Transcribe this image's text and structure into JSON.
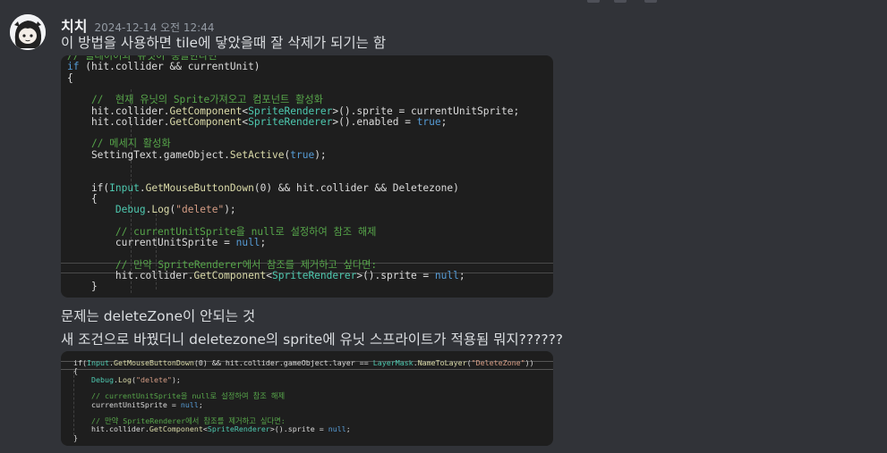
{
  "message": {
    "username": "치치",
    "timestamp": "2024-12-14 오전 12:44",
    "line1": "이 방법을 사용하면 tile에 닿았을때 잘 삭제가 되기는 함",
    "line2": "문제는 deleteZone이 안되는 것",
    "line3": "새 조건으로 바꿨더니 deletezone의 sprite에 유닛 스프라이트가 적용됨 뭐지??????"
  },
  "code1": {
    "lines": [
      [
        {
          "t": "// 플레이어와 유닛이 충돌한다면",
          "c": "cm"
        }
      ],
      [
        {
          "t": "if",
          "c": "kw"
        },
        {
          "t": " (hit.collider && currentUnit)",
          "c": "pl"
        }
      ],
      [
        {
          "t": "{",
          "c": "pl"
        }
      ],
      [
        {
          "t": "",
          "c": "pl"
        }
      ],
      [
        {
          "t": "    //  현재 유닛의 Sprite가져오고 컴포넌트 활성화",
          "c": "cm"
        }
      ],
      [
        {
          "t": "    hit.collider.",
          "c": "pl"
        },
        {
          "t": "GetComponent",
          "c": "fn"
        },
        {
          "t": "<",
          "c": "pl"
        },
        {
          "t": "SpriteRenderer",
          "c": "ty"
        },
        {
          "t": ">().sprite = currentUnitSprite;",
          "c": "pl"
        }
      ],
      [
        {
          "t": "    hit.collider.",
          "c": "pl"
        },
        {
          "t": "GetComponent",
          "c": "fn"
        },
        {
          "t": "<",
          "c": "pl"
        },
        {
          "t": "SpriteRenderer",
          "c": "ty"
        },
        {
          "t": ">().enabled = ",
          "c": "pl"
        },
        {
          "t": "true",
          "c": "kw"
        },
        {
          "t": ";",
          "c": "pl"
        }
      ],
      [
        {
          "t": "",
          "c": "pl"
        }
      ],
      [
        {
          "t": "    // 메세지 활성화",
          "c": "cm"
        }
      ],
      [
        {
          "t": "    SettingText.gameObject.",
          "c": "pl"
        },
        {
          "t": "SetActive",
          "c": "fn"
        },
        {
          "t": "(",
          "c": "pl"
        },
        {
          "t": "true",
          "c": "kw"
        },
        {
          "t": ");",
          "c": "pl"
        }
      ],
      [
        {
          "t": "",
          "c": "pl"
        }
      ],
      [
        {
          "t": "",
          "c": "pl"
        }
      ],
      [
        {
          "t": "    if(",
          "c": "pl"
        },
        {
          "t": "Input",
          "c": "ty"
        },
        {
          "t": ".",
          "c": "pl"
        },
        {
          "t": "GetMouseButtonDown",
          "c": "fn"
        },
        {
          "t": "(0) && hit.collider && Deletezone)",
          "c": "pl"
        }
      ],
      [
        {
          "t": "    {",
          "c": "pl"
        }
      ],
      [
        {
          "t": "        ",
          "c": "pl"
        },
        {
          "t": "Debug",
          "c": "ty"
        },
        {
          "t": ".",
          "c": "pl"
        },
        {
          "t": "Log",
          "c": "fn"
        },
        {
          "t": "(",
          "c": "pl"
        },
        {
          "t": "\"delete\"",
          "c": "st"
        },
        {
          "t": ");",
          "c": "pl"
        }
      ],
      [
        {
          "t": "",
          "c": "pl"
        }
      ],
      [
        {
          "t": "        // currentUnitSprite을 null로 설정하여 참조 해제",
          "c": "cm"
        }
      ],
      [
        {
          "t": "        currentUnitSprite = ",
          "c": "pl"
        },
        {
          "t": "null",
          "c": "kw"
        },
        {
          "t": ";",
          "c": "pl"
        }
      ],
      [
        {
          "t": "",
          "c": "pl"
        }
      ],
      [
        {
          "t": "        // 만약 SpriteRenderer에서 참조를 제거하고 싶다면:",
          "c": "cm"
        }
      ],
      [
        {
          "t": "        hit.collider.",
          "c": "pl"
        },
        {
          "t": "GetComponent",
          "c": "fn"
        },
        {
          "t": "<",
          "c": "pl"
        },
        {
          "t": "SpriteRenderer",
          "c": "ty"
        },
        {
          "t": ">().sprite = ",
          "c": "pl"
        },
        {
          "t": "null",
          "c": "kw"
        },
        {
          "t": ";",
          "c": "pl"
        }
      ],
      [
        {
          "t": "    }",
          "c": "pl"
        }
      ]
    ]
  },
  "code2": {
    "lines": [
      [
        {
          "t": "if(",
          "c": "pl"
        },
        {
          "t": "Input",
          "c": "ty"
        },
        {
          "t": ".",
          "c": "pl"
        },
        {
          "t": "GetMouseButtonDown",
          "c": "fn"
        },
        {
          "t": "(0) && hit.collider.gameObject.layer == ",
          "c": "pl"
        },
        {
          "t": "LayerMask",
          "c": "ty"
        },
        {
          "t": ".",
          "c": "pl"
        },
        {
          "t": "NameToLayer",
          "c": "fn"
        },
        {
          "t": "(",
          "c": "pl"
        },
        {
          "t": "\"DeleteZone\"",
          "c": "st"
        },
        {
          "t": "))",
          "c": "pl"
        }
      ],
      [
        {
          "t": "{",
          "c": "pl"
        }
      ],
      [
        {
          "t": "    ",
          "c": "pl"
        },
        {
          "t": "Debug",
          "c": "ty"
        },
        {
          "t": ".",
          "c": "pl"
        },
        {
          "t": "Log",
          "c": "fn"
        },
        {
          "t": "(",
          "c": "pl"
        },
        {
          "t": "\"delete\"",
          "c": "st"
        },
        {
          "t": ");",
          "c": "pl"
        }
      ],
      [
        {
          "t": "",
          "c": "pl"
        }
      ],
      [
        {
          "t": "    // currentUnitSprite을 null로 설정하여 참조 해제",
          "c": "cm"
        }
      ],
      [
        {
          "t": "    currentUnitSprite = ",
          "c": "pl"
        },
        {
          "t": "null",
          "c": "kw"
        },
        {
          "t": ";",
          "c": "pl"
        }
      ],
      [
        {
          "t": "",
          "c": "pl"
        }
      ],
      [
        {
          "t": "    // 만약 SpriteRenderer에서 참조를 제거하고 싶다면:",
          "c": "cm"
        }
      ],
      [
        {
          "t": "    hit.collider.",
          "c": "pl"
        },
        {
          "t": "GetComponent",
          "c": "fn"
        },
        {
          "t": "<",
          "c": "pl"
        },
        {
          "t": "SpriteRenderer",
          "c": "ty"
        },
        {
          "t": ">().sprite = ",
          "c": "pl"
        },
        {
          "t": "null",
          "c": "kw"
        },
        {
          "t": ";",
          "c": "pl"
        }
      ],
      [
        {
          "t": "}",
          "c": "pl"
        }
      ]
    ]
  }
}
